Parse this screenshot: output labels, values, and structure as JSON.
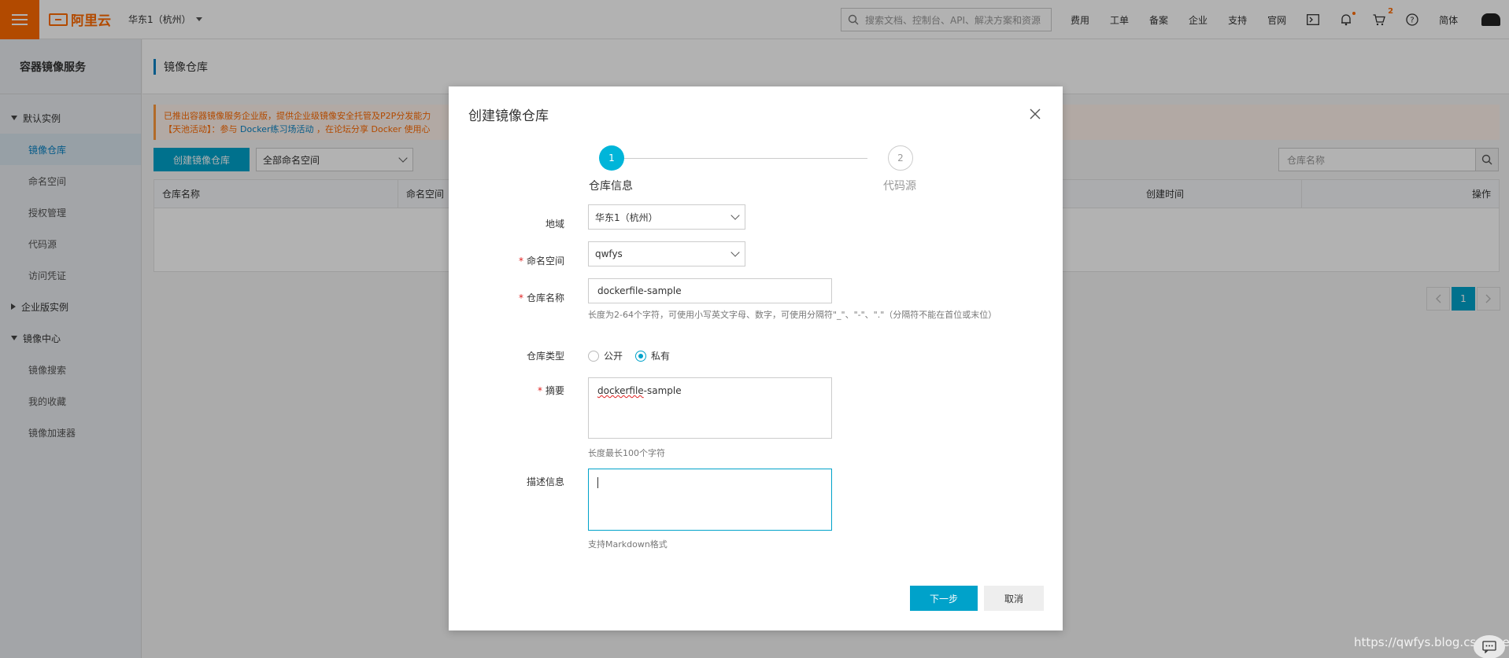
{
  "topbar": {
    "logo_text": "阿里云",
    "region": "华东1（杭州）",
    "search_placeholder": "搜索文档、控制台、API、解决方案和资源",
    "links": [
      "费用",
      "工单",
      "备案",
      "企业",
      "支持",
      "官网"
    ],
    "cart_count": "2",
    "language": "简体"
  },
  "sidebar": {
    "title": "容器镜像服务",
    "groups": [
      {
        "label": "默认实例",
        "items": [
          "镜像仓库",
          "命名空间",
          "授权管理",
          "代码源",
          "访问凭证"
        ]
      },
      {
        "label": "企业版实例"
      },
      {
        "label": "镜像中心",
        "items": [
          "镜像搜索",
          "我的收藏",
          "镜像加速器"
        ]
      }
    ]
  },
  "main": {
    "page_title": "镜像仓库",
    "notice_line1": "已推出容器镜像服务企业版，提供企业级镜像安全托管及P2P分发能力",
    "notice_line2_pre": "【天池活动】：参与",
    "notice_line2_link": "Docker练习场活动",
    "notice_line2_post": "，在论坛分享 Docker 使用心",
    "create_button": "创建镜像仓库",
    "namespace_filter": "全部命名空间",
    "repo_search_placeholder": "仓库名称",
    "table_headers": [
      "仓库名称",
      "命名空间",
      "创建时间",
      "操作"
    ],
    "page_number": "1"
  },
  "dialog": {
    "title": "创建镜像仓库",
    "steps": [
      {
        "number": "1",
        "label": "仓库信息"
      },
      {
        "number": "2",
        "label": "代码源"
      }
    ],
    "fields": {
      "region_label": "地域",
      "region_value": "华东1（杭州）",
      "namespace_label": "命名空间",
      "namespace_value": "qwfys",
      "repo_name_label": "仓库名称",
      "repo_name_value": "dockerfile-sample",
      "repo_name_hint": "长度为2-64个字符，可使用小写英文字母、数字，可使用分隔符\"_\"、\"-\"、\".\"（分隔符不能在首位或末位）",
      "repo_type_label": "仓库类型",
      "repo_type_public": "公开",
      "repo_type_private": "私有",
      "summary_label": "摘要",
      "summary_value_word": "dockerfile",
      "summary_value_rest": "-sample",
      "summary_hint": "长度最长100个字符",
      "description_label": "描述信息",
      "description_hint": "支持Markdown格式"
    },
    "next_button": "下一步",
    "cancel_button": "取消"
  },
  "watermark": "https://qwfys.blog.csdn.net"
}
